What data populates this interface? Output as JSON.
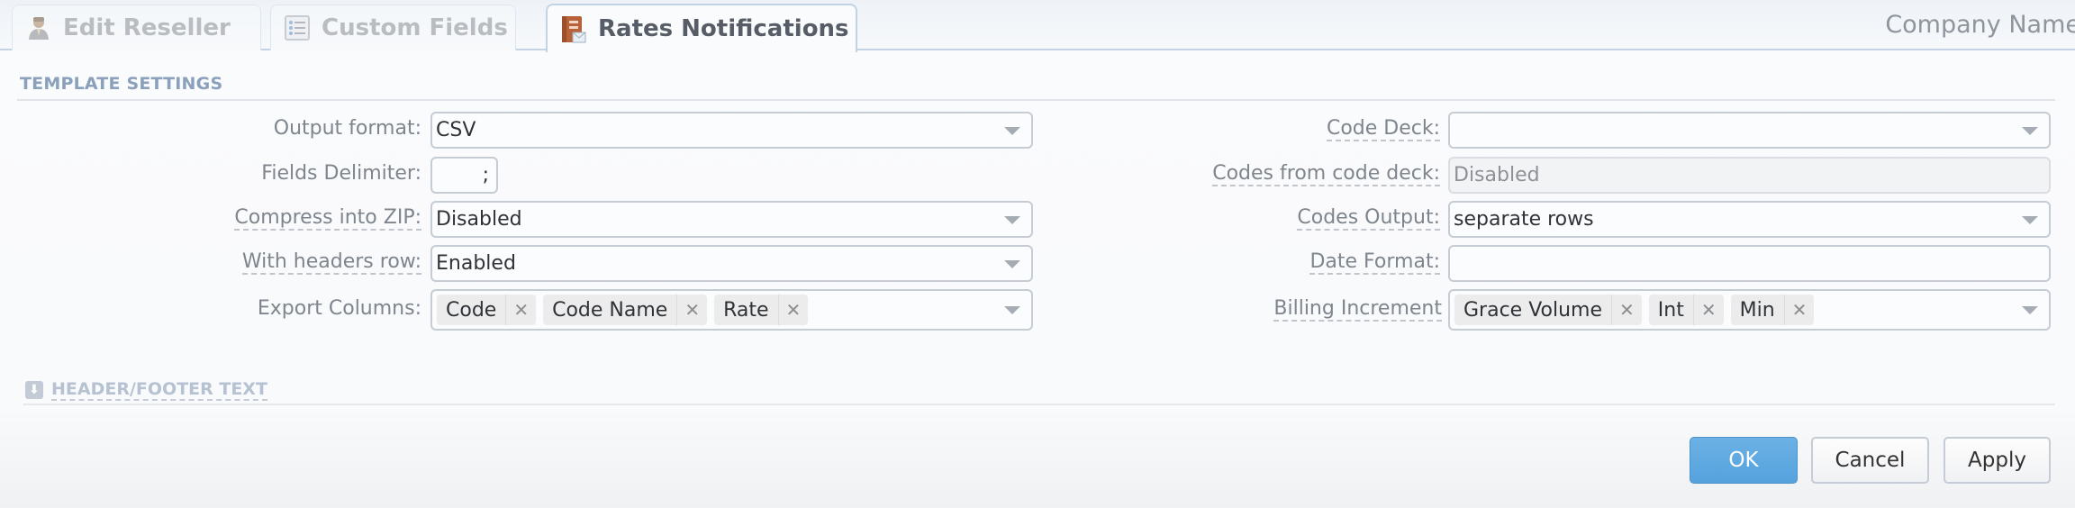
{
  "tabs": [
    {
      "label": "Edit Reseller",
      "icon": "user-icon",
      "active": false
    },
    {
      "label": "Custom Fields",
      "icon": "list-icon",
      "active": false
    },
    {
      "label": "Rates Notifications",
      "icon": "book-mail-icon",
      "active": true
    }
  ],
  "header": {
    "company_name": "Company Name"
  },
  "template_settings": {
    "title": "TEMPLATE SETTINGS",
    "left": {
      "output_format": {
        "label": "Output format:",
        "value": "CSV"
      },
      "fields_delimiter": {
        "label": "Fields Delimiter:",
        "value": ";"
      },
      "compress_zip": {
        "label": "Compress into ZIP:",
        "value": "Disabled"
      },
      "headers_row": {
        "label": "With headers row:",
        "value": "Enabled"
      },
      "export_columns": {
        "label": "Export Columns:",
        "tags": [
          "Code",
          "Code Name",
          "Rate"
        ]
      }
    },
    "right": {
      "code_deck": {
        "label": "Code Deck:",
        "value": ""
      },
      "codes_from_deck": {
        "label": "Codes from code deck:",
        "value": "Disabled"
      },
      "codes_output": {
        "label": "Codes Output:",
        "value": "separate rows"
      },
      "date_format": {
        "label": "Date Format:",
        "value": ""
      },
      "billing_increment": {
        "label": "Billing Increment",
        "tags": [
          "Grace Volume",
          "Int",
          "Min"
        ]
      }
    }
  },
  "header_footer": {
    "title": "HEADER/FOOTER TEXT",
    "icon": "expand-down-icon"
  },
  "buttons": {
    "ok": "OK",
    "cancel": "Cancel",
    "apply": "Apply"
  },
  "colors": {
    "primary_button": "#5aa6e0",
    "section_title": "#8aa0bb",
    "active_tab_border": "#c3d3e4"
  }
}
